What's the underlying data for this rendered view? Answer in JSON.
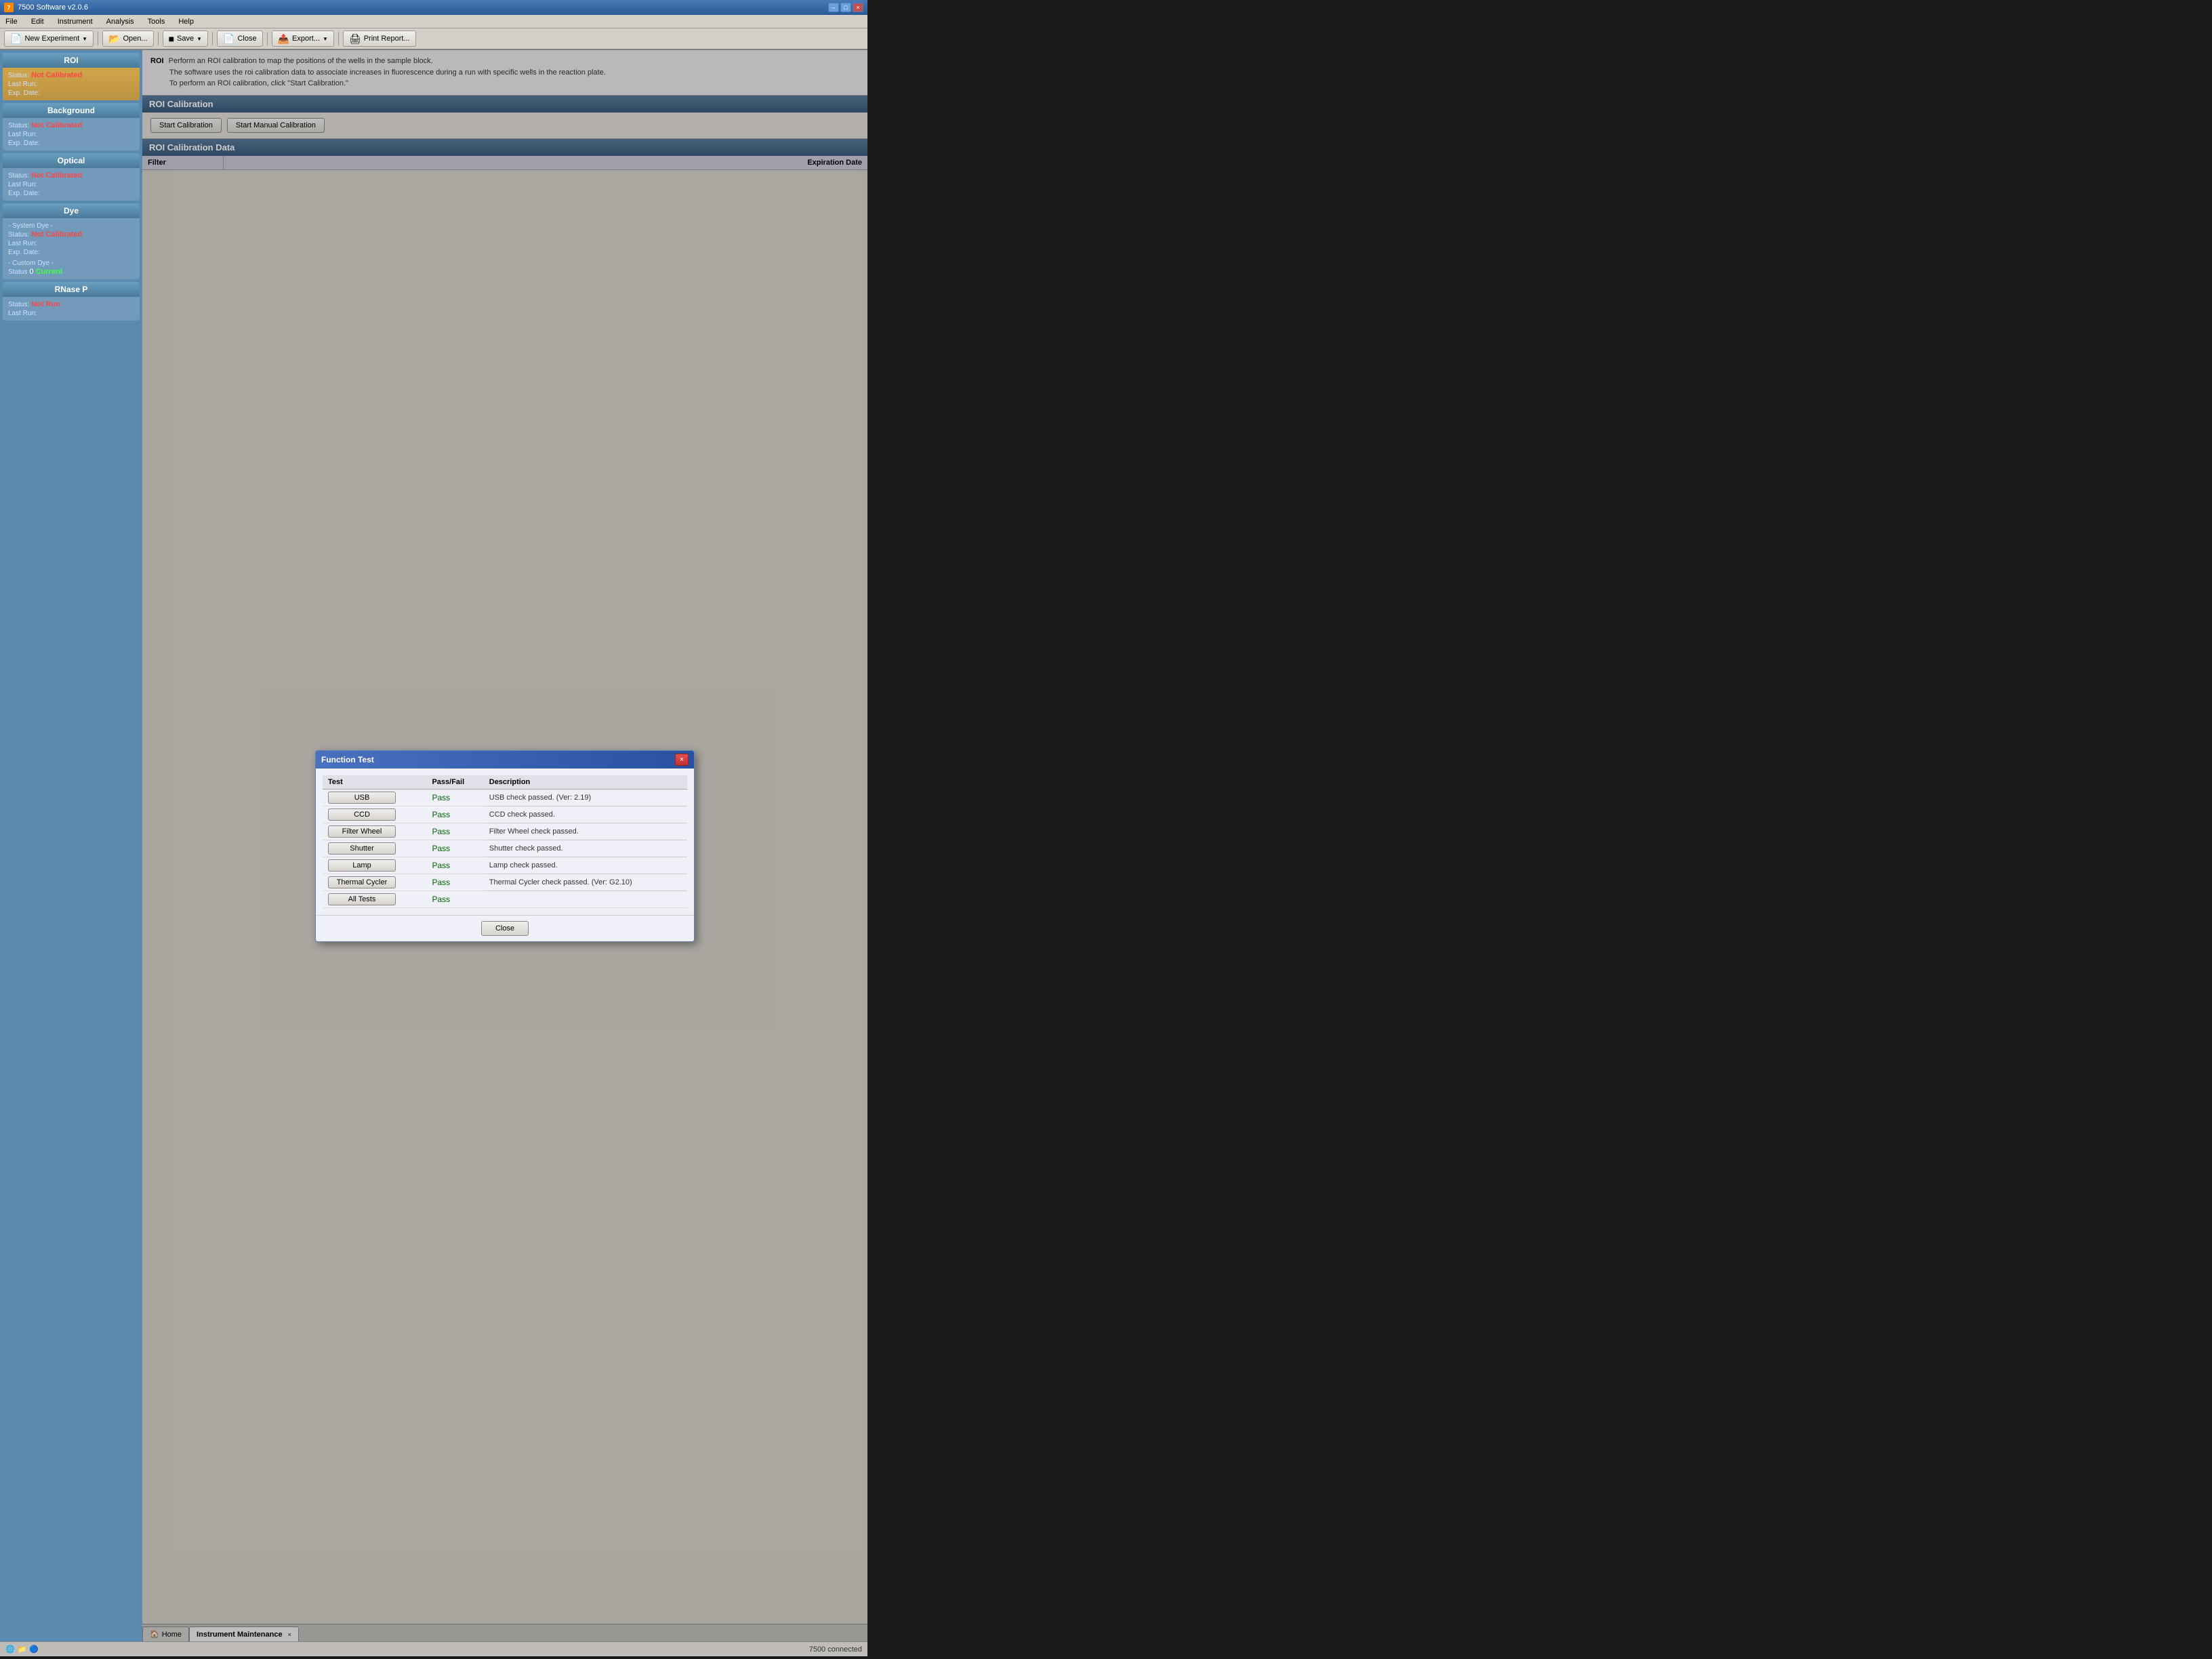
{
  "titleBar": {
    "title": "7500 Software v2.0.6",
    "minimizeLabel": "–",
    "maximizeLabel": "□",
    "closeLabel": "×"
  },
  "menuBar": {
    "items": [
      "File",
      "Edit",
      "Instrument",
      "Analysis",
      "Tools",
      "Help"
    ]
  },
  "toolbar": {
    "newExperiment": "New Experiment",
    "open": "Open...",
    "save": "Save",
    "close": "Close",
    "export": "Export...",
    "printReport": "Print Report..."
  },
  "sidebar": {
    "sections": [
      {
        "id": "roi",
        "title": "ROI",
        "highlight": true,
        "fields": [
          {
            "label": "Status:",
            "value": "Not Calibrated",
            "valueClass": "red"
          },
          {
            "label": "Last Run:",
            "value": ""
          },
          {
            "label": "Exp. Date:",
            "value": ""
          }
        ]
      },
      {
        "id": "background",
        "title": "Background",
        "highlight": false,
        "fields": [
          {
            "label": "Status:",
            "value": "Not Calibrated",
            "valueClass": "red"
          },
          {
            "label": "Last Run:",
            "value": ""
          },
          {
            "label": "Exp. Date:",
            "value": ""
          }
        ]
      },
      {
        "id": "optical",
        "title": "Optical",
        "highlight": false,
        "fields": [
          {
            "label": "Status:",
            "value": "Not Calibrated",
            "valueClass": "red"
          },
          {
            "label": "Last Run:",
            "value": ""
          },
          {
            "label": "Exp. Date:",
            "value": ""
          }
        ]
      },
      {
        "id": "dye",
        "title": "Dye",
        "highlight": false,
        "fields": [
          {
            "label": "- System Dye -",
            "value": ""
          },
          {
            "label": "Status:",
            "value": "Not Calibrated",
            "valueClass": "red"
          },
          {
            "label": "Last Run:",
            "value": ""
          },
          {
            "label": "Exp. Date:",
            "value": ""
          },
          {
            "label": "- Custom Dye -",
            "value": ""
          },
          {
            "label": "Status",
            "value": "0",
            "valueClass": ""
          },
          {
            "label": "",
            "value": "Current",
            "valueClass": "green"
          }
        ]
      },
      {
        "id": "rnasep",
        "title": "RNase P",
        "highlight": false,
        "fields": [
          {
            "label": "Status:",
            "value": "Not Run",
            "valueClass": "red"
          },
          {
            "label": "Last Run:",
            "value": ""
          }
        ]
      }
    ]
  },
  "roiBanner": {
    "label": "ROI",
    "lines": [
      "Perform an ROI calibration to map the positions of the wells in the sample block.",
      "The software uses the roi calibration data to associate increases in fluorescence during a run with specific wells in the reaction plate.",
      "To perform an ROI calibration, click \"Start Calibration.\""
    ]
  },
  "roiCalibration": {
    "sectionTitle": "ROI Calibration",
    "startBtn": "Start Calibration",
    "startManualBtn": "Start Manual Calibration"
  },
  "roiCalibrationData": {
    "sectionTitle": "ROI Calibration Data",
    "tableHeaders": {
      "filter": "Filter",
      "expirationDate": "Expiration Date"
    }
  },
  "functionTestDialog": {
    "title": "Function Test",
    "closeBtn": "×",
    "tableHeaders": [
      "Test",
      "Pass/Fail",
      "Description"
    ],
    "tests": [
      {
        "name": "USB",
        "result": "Pass",
        "description": "USB check passed. (Ver: 2.19)"
      },
      {
        "name": "CCD",
        "result": "Pass",
        "description": "CCD check passed."
      },
      {
        "name": "Filter Wheel",
        "result": "Pass",
        "description": "Filter Wheel check passed."
      },
      {
        "name": "Shutter",
        "result": "Pass",
        "description": "Shutter check passed."
      },
      {
        "name": "Lamp",
        "result": "Pass",
        "description": "Lamp check passed."
      },
      {
        "name": "Thermal Cycler",
        "result": "Pass",
        "description": "Thermal Cycler check passed. (Ver: G2.10)"
      },
      {
        "name": "All Tests",
        "result": "Pass",
        "description": ""
      }
    ],
    "closeButtonLabel": "Close"
  },
  "bottomTabs": [
    {
      "label": "Home",
      "closeable": false,
      "active": false
    },
    {
      "label": "Instrument Maintenance",
      "closeable": true,
      "active": true
    }
  ],
  "statusBar": {
    "connectionStatus": "7500  connected"
  }
}
